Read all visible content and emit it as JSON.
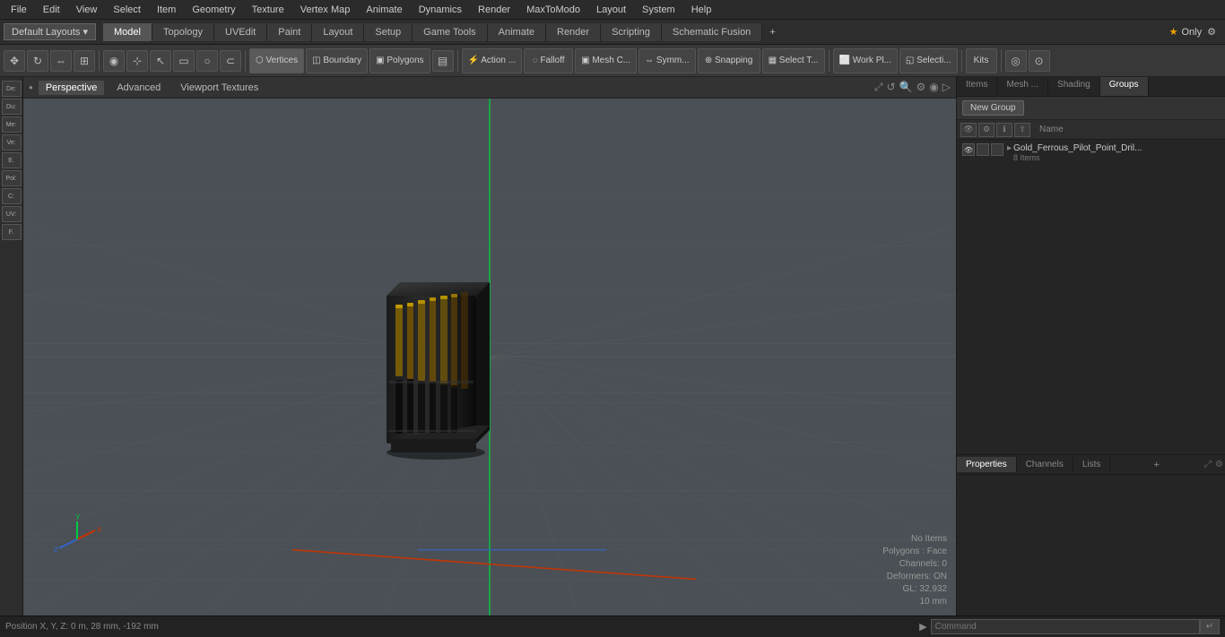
{
  "menubar": {
    "items": [
      "File",
      "Edit",
      "View",
      "Select",
      "Item",
      "Geometry",
      "Texture",
      "Vertex Map",
      "Animate",
      "Dynamics",
      "Render",
      "MaxToModo",
      "Layout",
      "System",
      "Help"
    ]
  },
  "layout_bar": {
    "default_layouts": "Default Layouts ▾",
    "tabs": [
      "Model",
      "Topology",
      "UVEdit",
      "Paint",
      "Layout",
      "Setup",
      "Game Tools",
      "Animate",
      "Render",
      "Scripting",
      "Schematic Fusion"
    ],
    "add_icon": "+",
    "star_label": "★ Only",
    "settings_icon": "⚙"
  },
  "toolbar": {
    "buttons": [
      {
        "id": "move",
        "label": "✥"
      },
      {
        "id": "rotate",
        "label": "↻"
      },
      {
        "id": "scale",
        "label": "⇔"
      },
      {
        "id": "transform",
        "label": "⊞"
      },
      {
        "id": "sphere",
        "label": "◉"
      },
      {
        "id": "cursor",
        "label": "⊹"
      },
      {
        "id": "arrow",
        "label": "↖"
      },
      {
        "id": "rect",
        "label": "▭"
      },
      {
        "id": "circle",
        "label": "○"
      },
      {
        "id": "magnet",
        "label": "⊂"
      },
      {
        "id": "vertices",
        "label": "Vertices"
      },
      {
        "id": "boundary",
        "label": "Boundary"
      },
      {
        "id": "polygons",
        "label": "Polygons"
      },
      {
        "id": "mesh",
        "label": "▣"
      },
      {
        "id": "action",
        "label": "Action ..."
      },
      {
        "id": "falloff",
        "label": "Falloff"
      },
      {
        "id": "meshc",
        "label": "Mesh C..."
      },
      {
        "id": "symm",
        "label": "Symm..."
      },
      {
        "id": "snapping",
        "label": "⊕ Snapping"
      },
      {
        "id": "selectt",
        "label": "Select T..."
      },
      {
        "id": "workpl",
        "label": "Work Pl..."
      },
      {
        "id": "selecti",
        "label": "Selecti..."
      },
      {
        "id": "kits",
        "label": "Kits"
      },
      {
        "id": "cam1",
        "label": "◎"
      },
      {
        "id": "cam2",
        "label": "⊙"
      }
    ]
  },
  "viewport": {
    "tabs": [
      "Perspective",
      "Advanced",
      "Viewport Textures"
    ],
    "controls": [
      "⊙",
      "↺",
      "🔍",
      "⚙",
      "◉",
      "▷"
    ]
  },
  "sidebar_labels": [
    "De:",
    "Du:",
    "Me:",
    "Ve:",
    "E.",
    "Pol:",
    "C:",
    "UV:",
    "F."
  ],
  "right_panel": {
    "tabs": [
      "Items",
      "Mesh ...",
      "Shading",
      "Groups"
    ],
    "active_tab": "Groups",
    "new_group_label": "New Group",
    "toolbar_icons": [
      "👁",
      "⚙",
      "ℹ",
      "⇧"
    ],
    "name_col": "Name",
    "group_item": {
      "name": "Gold_Ferrous_Pilot_Point_Dril...",
      "sub": "8 Items"
    }
  },
  "properties_panel": {
    "tabs": [
      "Properties",
      "Channels",
      "Lists"
    ],
    "active_tab": "Properties",
    "add_icon": "+"
  },
  "status": {
    "no_items": "No Items",
    "polygons": "Polygons : Face",
    "channels": "Channels: 0",
    "deformers": "Deformers: ON",
    "gl": "GL: 32,932",
    "size": "10 mm"
  },
  "command_bar": {
    "position": "Position X, Y, Z:  0 m, 28 mm, -192 mm",
    "placeholder": "Command",
    "arrow": "▶"
  }
}
